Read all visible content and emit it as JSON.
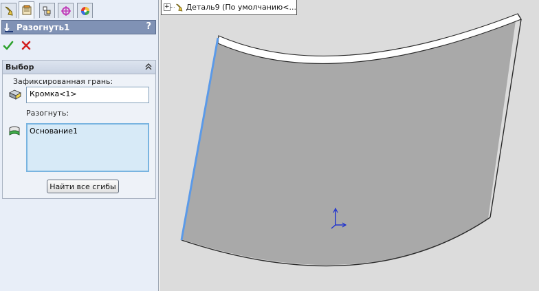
{
  "tabs": [
    {
      "icon": "feature-manager-icon"
    },
    {
      "icon": "property-manager-icon"
    },
    {
      "icon": "configuration-manager-icon"
    },
    {
      "icon": "dimxpert-icon"
    },
    {
      "icon": "display-manager-icon"
    }
  ],
  "property_manager": {
    "title": "Разогнуть1",
    "help": "?",
    "ok_icon": "check-icon",
    "cancel_icon": "x-icon"
  },
  "selection_group": {
    "title": "Выбор",
    "fixed_face_label": "Зафиксированная грань:",
    "fixed_face_value": "Кромка<1>",
    "unfold_label": "Разогнуть:",
    "unfold_items": [
      "Основание1"
    ],
    "collect_button": "Найти все сгибы"
  },
  "feature_tree": {
    "expander": "+",
    "part_name": "Деталь9  (По умолчанию<..."
  },
  "colors": {
    "panel_bg": "#e8eef8",
    "title_bar": "#8092b5",
    "viewport_bg": "#dcdcdc",
    "model_face": "#a9a9a9",
    "selected_edge": "#5b9ae8"
  }
}
